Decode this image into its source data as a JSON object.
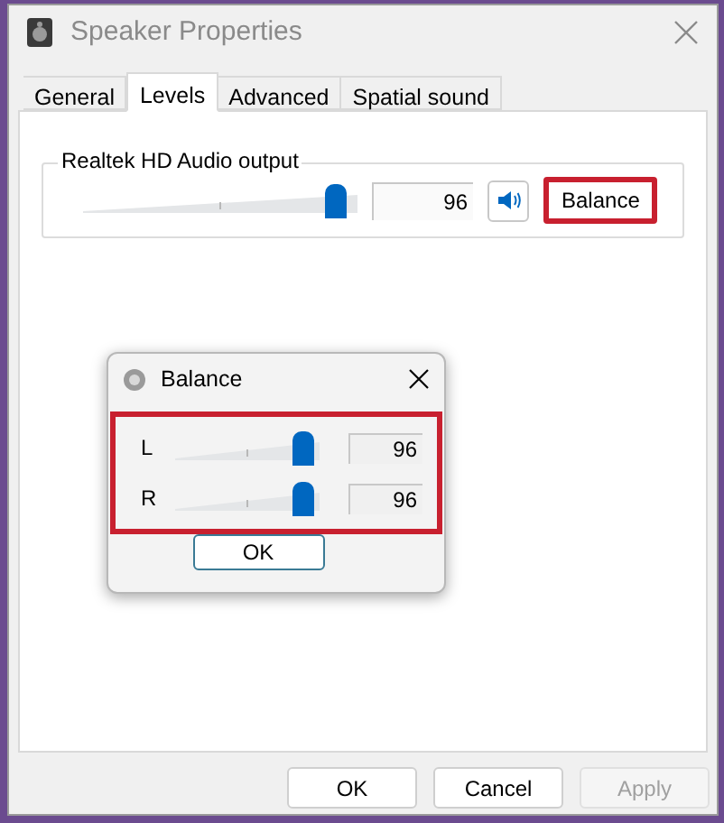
{
  "window": {
    "title": "Speaker Properties",
    "active": false
  },
  "tabs": [
    {
      "label": "General",
      "selected": false
    },
    {
      "label": "Levels",
      "selected": true
    },
    {
      "label": "Advanced",
      "selected": false
    },
    {
      "label": "Spatial sound",
      "selected": false
    }
  ],
  "device": {
    "name": "Realtek HD Audio output",
    "level": 0.96,
    "value": "96",
    "muted": false,
    "balance_button": {
      "label": "Balance",
      "highlighted": true
    }
  },
  "balance_dialog": {
    "title": "Balance",
    "highlighted": true,
    "ok": "OK",
    "channels": [
      {
        "label": "L",
        "level": 0.96,
        "value": "96"
      },
      {
        "label": "R",
        "level": 0.96,
        "value": "96"
      }
    ]
  },
  "buttons": [
    {
      "label": "OK",
      "disabled": false
    },
    {
      "label": "Cancel",
      "disabled": false
    },
    {
      "label": "Apply",
      "disabled": true
    }
  ]
}
